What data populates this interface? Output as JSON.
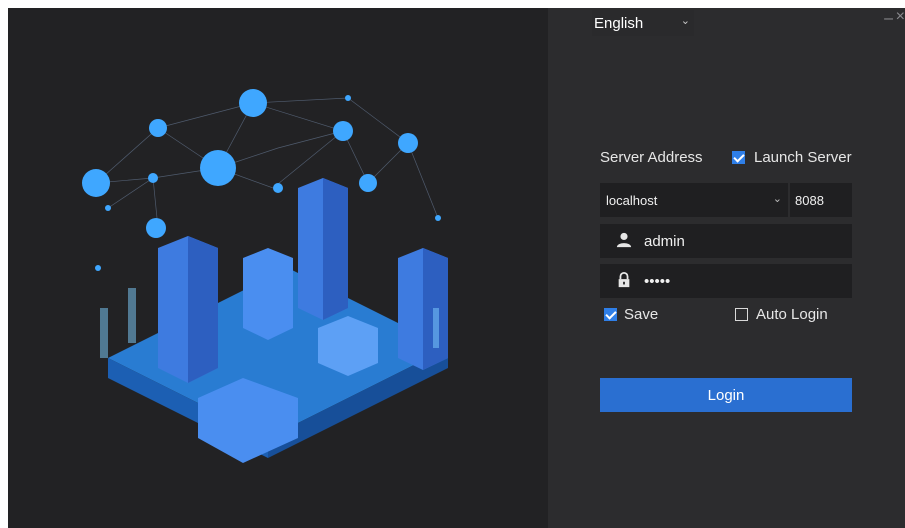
{
  "language": {
    "selected": "English"
  },
  "window_controls": {
    "minimize": "–",
    "close": "×"
  },
  "server": {
    "label": "Server Address",
    "launch_server_label": "Launch Server",
    "launch_server_checked": true,
    "address": "localhost",
    "port": "8088"
  },
  "credentials": {
    "username": "admin",
    "password_mask": "•••••"
  },
  "options": {
    "save_label": "Save",
    "save_checked": true,
    "auto_login_label": "Auto Login",
    "auto_login_checked": false
  },
  "login_button": {
    "label": "Login"
  },
  "colors": {
    "accent": "#2a6fd1",
    "checkbox": "#2f7fe8",
    "panel_dark": "#222224",
    "panel_right": "#2c2c2e",
    "illustration_blue": "#4aa9ff"
  },
  "icons": {
    "user": "user-icon",
    "lock": "lock-icon",
    "chevron": "chevron-down-icon"
  }
}
